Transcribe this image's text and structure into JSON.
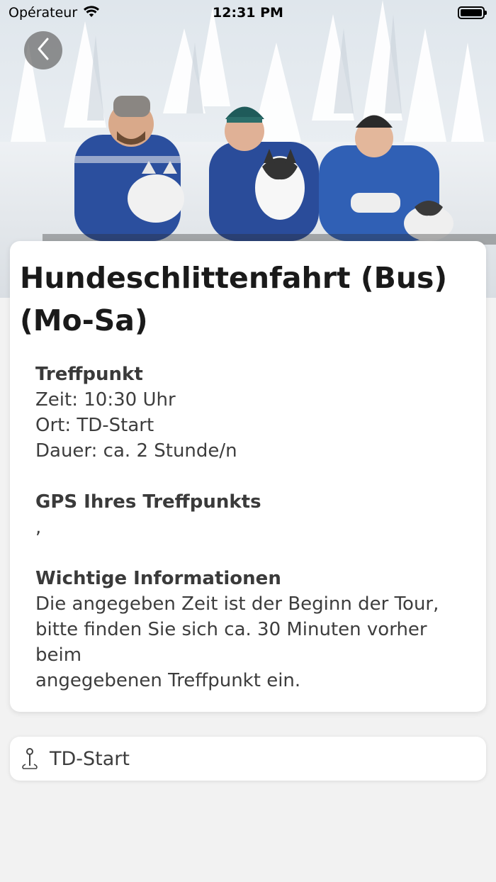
{
  "status_bar": {
    "carrier": "Opérateur",
    "time": "12:31 PM"
  },
  "hero": {
    "image_description_icon": "photo-dog-sledding-group"
  },
  "info": {
    "title_line1": "Hundeschlittenfahrt (Bus)",
    "title_line2": "(Mo-Sa)",
    "meeting_point": {
      "heading": "Treffpunkt",
      "time": "Zeit: 10:30 Uhr",
      "place": "Ort: TD-Start",
      "duration": "Dauer: ca. 2 Stunde/n"
    },
    "gps": {
      "heading": "GPS Ihres Treffpunkts",
      "value": ","
    },
    "important": {
      "heading": "Wichtige Informationen",
      "line1": "Die angegeben Zeit ist der Beginn der Tour,",
      "line2": "bitte finden Sie sich ca. 30 Minuten vorher beim",
      "line3": "angegebenen Treffpunkt ein."
    }
  },
  "location": {
    "icon": "map-pin-icon",
    "label": "TD-Start"
  },
  "colors": {
    "background": "#f2f2f2",
    "card": "#ffffff",
    "title_text": "#1a1a1a",
    "body_text": "#3d3d3d"
  }
}
